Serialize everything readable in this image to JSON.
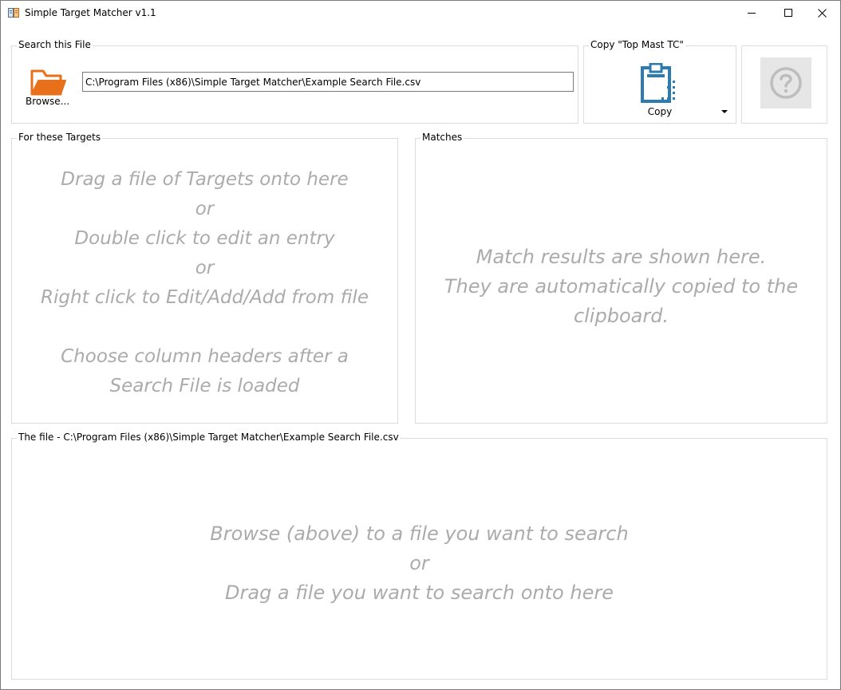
{
  "window": {
    "title": "Simple Target Matcher v1.1",
    "controls": [
      "minimize",
      "maximize",
      "close"
    ]
  },
  "search": {
    "group_label": "Search this File",
    "browse_label": "Browse...",
    "file_path": "C:\\Program Files (x86)\\Simple Target Matcher\\Example Search File.csv"
  },
  "copy": {
    "group_label": "Copy \"Top Mast TC\"",
    "button_label": "Copy"
  },
  "targets": {
    "group_label": "For these Targets",
    "hint_lines": [
      "Drag a file of Targets onto here",
      "or",
      "Double click to edit an entry",
      "or",
      "Right click to Edit/Add/Add from file",
      "",
      "Choose column headers after a",
      "Search File is loaded"
    ]
  },
  "matches": {
    "group_label": "Matches",
    "hint_lines": [
      "Match results are shown here.",
      "They are automatically copied to the",
      "clipboard."
    ]
  },
  "file": {
    "group_label": "The file - C:\\Program Files (x86)\\Simple Target Matcher\\Example Search File.csv",
    "hint_lines": [
      "Browse (above) to a file you want to search",
      "or",
      "Drag a file you want to search onto here"
    ]
  },
  "icons": {
    "app": "app-icon",
    "browse": "folder-open-icon",
    "copy": "clipboard-icon",
    "help": "question-icon",
    "dropdown": "caret-down-icon"
  },
  "colors": {
    "folder": "#e8701a",
    "clipboard": "#2d7bb0",
    "hint_text": "#ababab"
  }
}
